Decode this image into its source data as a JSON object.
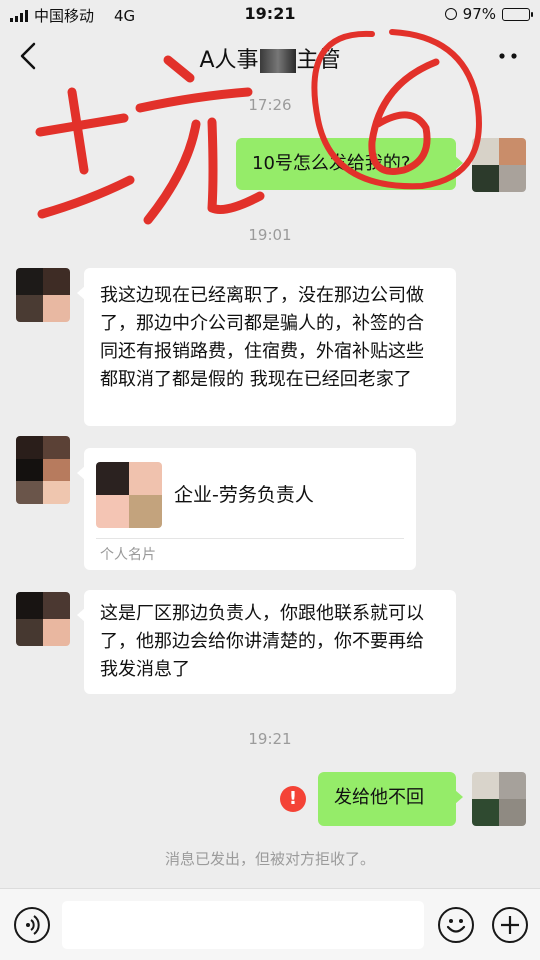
{
  "status_bar": {
    "carrier": "中国移动",
    "network": "4G",
    "time": "19:21",
    "battery": "97%",
    "battery_level": 0.97
  },
  "nav": {
    "title_prefix": "A人事",
    "title_suffix": "主管",
    "more_icon": "more-dots-icon",
    "back_icon": "chevron-left-icon"
  },
  "messages": {
    "ts1": "17:26",
    "out1": "10号怎么发给我的?",
    "ts2": "19:01",
    "in1": "我这边现在已经离职了，没在那边公司做了，那边中介公司都是骗人的，补签的合同还有报销路费，住宿费，外宿补贴这些都取消了都是假的 我现在已经回老家了",
    "card_name": "企业-劳务负责人",
    "card_label": "个人名片",
    "in2": "这是厂区那边负责人，你跟他联系就可以了，他那边会给你讲清楚的，你不要再给我发消息了",
    "ts3": "19:21",
    "out2": "发给他不回",
    "error_mark": "!",
    "notice": "消息已发出，但被对方拒收了。"
  },
  "annotation": {
    "text": "坑",
    "number": "6",
    "color": "#e2312a"
  },
  "input_bar": {
    "placeholder": "",
    "voice_icon": "voice-icon",
    "emoji_icon": "emoji-icon",
    "plus_icon": "plus-icon"
  },
  "colors": {
    "outgoing_bubble": "#95ec69",
    "incoming_bubble": "#ffffff",
    "background": "#ededed",
    "error": "#f44336"
  }
}
